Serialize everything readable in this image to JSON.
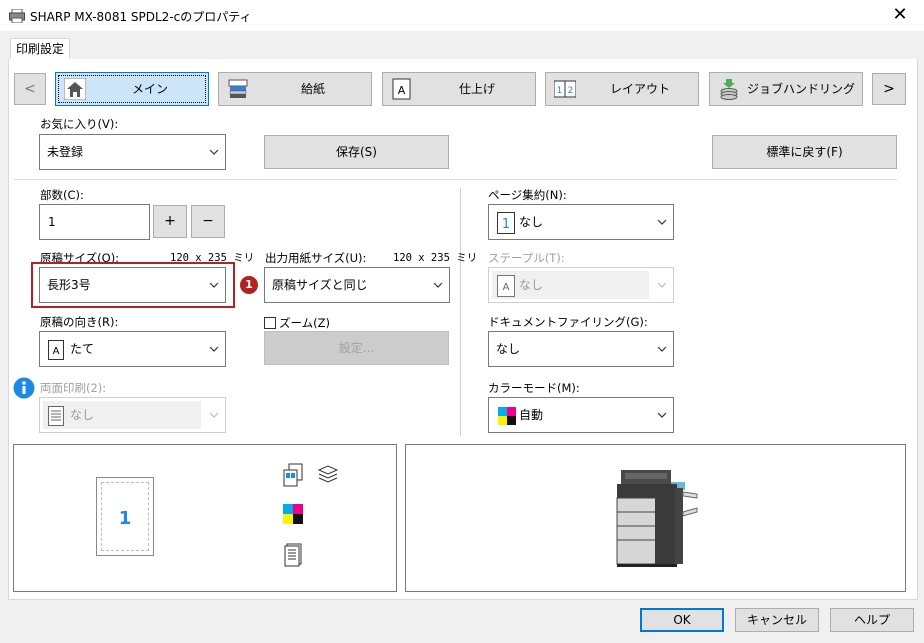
{
  "window": {
    "title": "SHARP MX-8081 SPDL2-cのプロパティ",
    "close": "✕"
  },
  "tabs": [
    {
      "label": "印刷設定"
    }
  ],
  "nav": {
    "prev": "<",
    "next": ">",
    "items": [
      {
        "label": "メイン",
        "icon": "home-icon"
      },
      {
        "label": "給紙",
        "icon": "paper-tray-icon"
      },
      {
        "label": "仕上げ",
        "icon": "finishing-icon"
      },
      {
        "label": "レイアウト",
        "icon": "layout-icon"
      },
      {
        "label": "ジョブハンドリング",
        "icon": "job-handling-icon"
      }
    ]
  },
  "favorites": {
    "label": "お気に入り(V):",
    "value": "未登録",
    "save": "保存(S)",
    "reset": "標準に戻す(F)"
  },
  "copies": {
    "label": "部数(C):",
    "value": "1",
    "plus": "+",
    "minus": "−"
  },
  "original_size": {
    "label": "原稿サイズ(O):",
    "dims": "120 x 235 ミリ",
    "value": "長形3号"
  },
  "output_size": {
    "label": "出力用紙サイズ(U):",
    "dims": "120 x 235 ミリ",
    "value": "原稿サイズと同じ"
  },
  "badge": "1",
  "orientation": {
    "label": "原稿の向き(R):",
    "value": "たて",
    "icon_text": "A"
  },
  "zoom": {
    "label": "ズーム(Z)",
    "settings": "設定..."
  },
  "duplex": {
    "label": "両面印刷(2):",
    "value": "なし"
  },
  "pages_per_sheet": {
    "label": "ページ集約(N):",
    "value": "なし",
    "icon_text": "1"
  },
  "staple": {
    "label": "ステープル(T):",
    "value": "なし",
    "icon_text": "A"
  },
  "doc_filing": {
    "label": "ドキュメントファイリング(G):",
    "value": "なし"
  },
  "color_mode": {
    "label": "カラーモード(M):",
    "value": "自動"
  },
  "preview": {
    "page_number": "1"
  },
  "footer": {
    "ok": "OK",
    "cancel": "キャンセル",
    "help": "ヘルプ"
  },
  "colors": {
    "accent": "#0078d7",
    "highlight": "#b22222",
    "info": "#1e88e5"
  }
}
